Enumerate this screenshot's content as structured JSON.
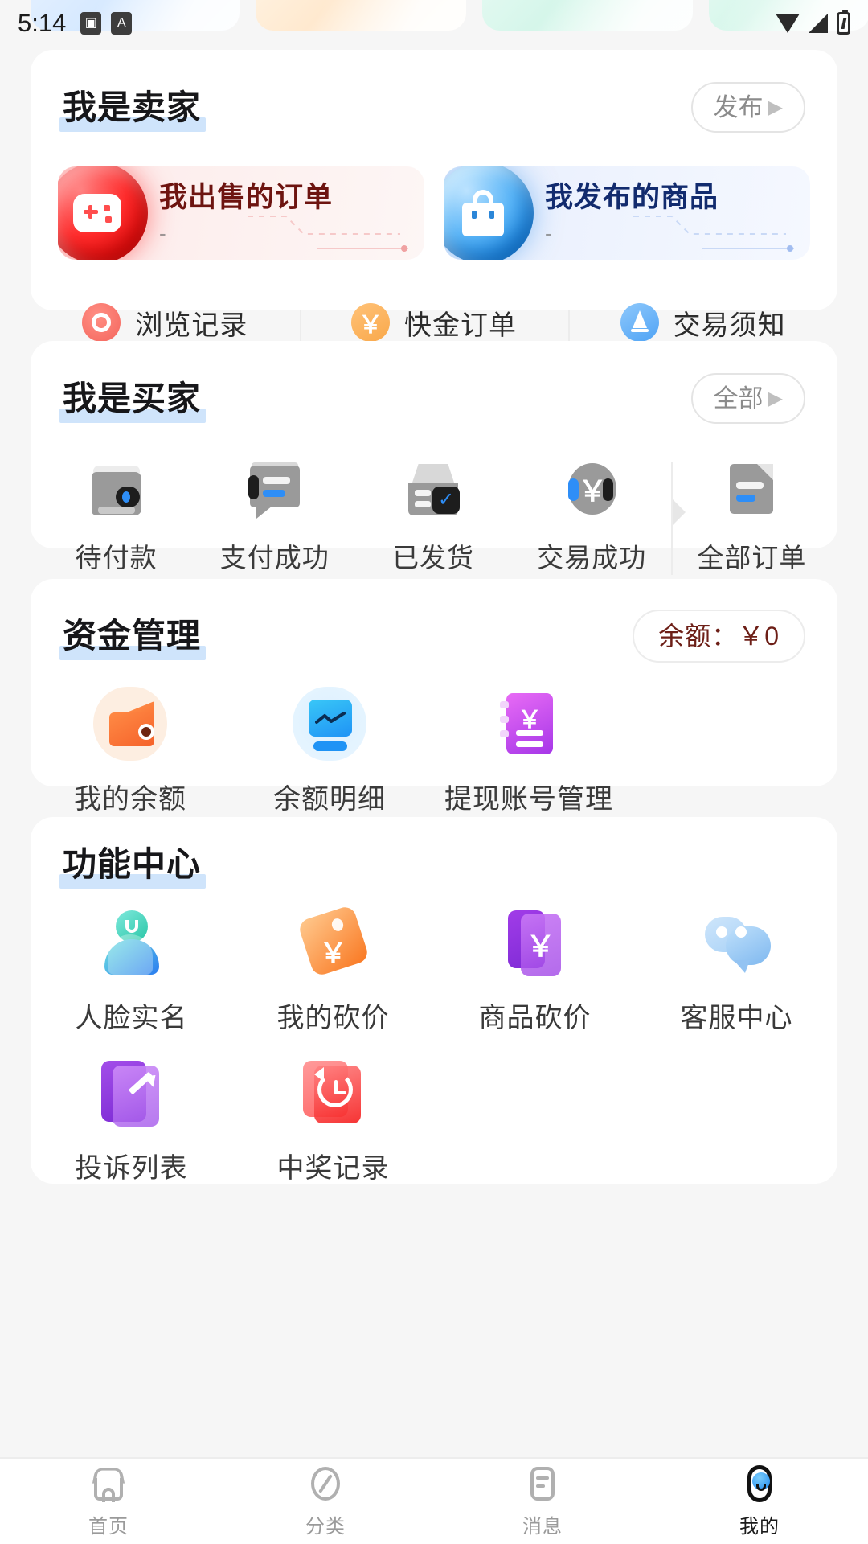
{
  "status_bar": {
    "time": "5:14",
    "left_icons": [
      "image-badge-icon",
      "a-badge-icon"
    ],
    "right_icons": [
      "wifi-icon",
      "signal-icon",
      "battery-charging-icon"
    ]
  },
  "seller": {
    "title": "我是卖家",
    "action_label": "发布",
    "action_chevron": "▶",
    "tiles": [
      {
        "title": "我出售的订单",
        "count": "-",
        "icon": "gamepad-orb-icon",
        "accent": "#e51414"
      },
      {
        "title": "我发布的商品",
        "count": "-",
        "icon": "shopping-bag-orb-icon",
        "accent": "#1783e0"
      }
    ],
    "quick_links": [
      {
        "label": "浏览记录",
        "icon": "eye-icon",
        "color": "#f4655c"
      },
      {
        "label": "快金订单",
        "icon": "yen-coin-icon",
        "color": "#f9a84a"
      },
      {
        "label": "交易须知",
        "icon": "pen-icon",
        "color": "#4fa3f5"
      }
    ]
  },
  "buyer": {
    "title": "我是买家",
    "action_label": "全部",
    "action_chevron": "▶",
    "statuses": [
      {
        "label": "待付款",
        "icon": "wallet-icon"
      },
      {
        "label": "支付成功",
        "icon": "chat-receipt-icon"
      },
      {
        "label": "已发货",
        "icon": "box-check-icon"
      },
      {
        "label": "交易成功",
        "icon": "yen-circle-icon"
      }
    ],
    "all_orders": {
      "label": "全部订单",
      "icon": "file-icon"
    }
  },
  "fund": {
    "title": "资金管理",
    "balance_label": "余额：￥0",
    "items": [
      {
        "label": "我的余额",
        "icon": "wallet-orange-icon"
      },
      {
        "label": "余额明细",
        "icon": "chart-card-blue-icon"
      },
      {
        "label": "提现账号管理",
        "icon": "yen-notebook-purple-icon"
      }
    ]
  },
  "functions": {
    "title": "功能中心",
    "items": [
      {
        "label": "人脸实名",
        "icon": "person-teal-icon"
      },
      {
        "label": "我的砍价",
        "icon": "price-tag-orange-icon"
      },
      {
        "label": "商品砍价",
        "icon": "yen-card-purple-icon"
      },
      {
        "label": "客服中心",
        "icon": "chat-bubbles-blue-icon"
      },
      {
        "label": "投诉列表",
        "icon": "edit-doc-purple-icon"
      },
      {
        "label": "中奖记录",
        "icon": "history-clock-red-icon"
      }
    ]
  },
  "tabbar": {
    "tabs": [
      {
        "label": "首页",
        "icon": "home-icon",
        "active": false
      },
      {
        "label": "分类",
        "icon": "compass-icon",
        "active": false
      },
      {
        "label": "消息",
        "icon": "message-icon",
        "active": false
      },
      {
        "label": "我的",
        "icon": "profile-icon",
        "active": true
      }
    ]
  },
  "theme": {
    "page_bg": "#f6f6f6",
    "card_bg": "#ffffff",
    "title_underline": "#cfe4fb",
    "accent_red": "#e51414",
    "accent_blue": "#1783e0",
    "balance_text": "#6d1f17"
  }
}
